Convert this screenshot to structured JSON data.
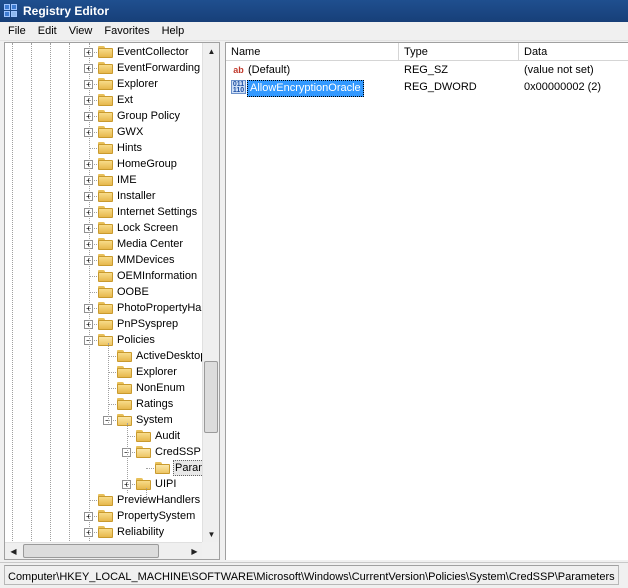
{
  "window": {
    "title": "Registry Editor"
  },
  "menu": [
    "File",
    "Edit",
    "View",
    "Favorites",
    "Help"
  ],
  "tree": {
    "items": [
      {
        "label": "EventCollector",
        "depth": 0,
        "expander": "plus"
      },
      {
        "label": "EventForwarding",
        "depth": 0,
        "expander": "plus"
      },
      {
        "label": "Explorer",
        "depth": 0,
        "expander": "plus"
      },
      {
        "label": "Ext",
        "depth": 0,
        "expander": "plus"
      },
      {
        "label": "Group Policy",
        "depth": 0,
        "expander": "plus"
      },
      {
        "label": "GWX",
        "depth": 0,
        "expander": "plus"
      },
      {
        "label": "Hints",
        "depth": 0,
        "expander": "none"
      },
      {
        "label": "HomeGroup",
        "depth": 0,
        "expander": "plus"
      },
      {
        "label": "IME",
        "depth": 0,
        "expander": "plus"
      },
      {
        "label": "Installer",
        "depth": 0,
        "expander": "plus"
      },
      {
        "label": "Internet Settings",
        "depth": 0,
        "expander": "plus"
      },
      {
        "label": "Lock Screen",
        "depth": 0,
        "expander": "plus"
      },
      {
        "label": "Media Center",
        "depth": 0,
        "expander": "plus"
      },
      {
        "label": "MMDevices",
        "depth": 0,
        "expander": "plus"
      },
      {
        "label": "OEMInformation",
        "depth": 0,
        "expander": "none"
      },
      {
        "label": "OOBE",
        "depth": 0,
        "expander": "none"
      },
      {
        "label": "PhotoPropertyHan",
        "depth": 0,
        "expander": "plus"
      },
      {
        "label": "PnPSysprep",
        "depth": 0,
        "expander": "plus"
      },
      {
        "label": "Policies",
        "depth": 0,
        "expander": "minus"
      },
      {
        "label": "ActiveDesktop",
        "depth": 1,
        "expander": "none"
      },
      {
        "label": "Explorer",
        "depth": 1,
        "expander": "none"
      },
      {
        "label": "NonEnum",
        "depth": 1,
        "expander": "none"
      },
      {
        "label": "Ratings",
        "depth": 1,
        "expander": "none"
      },
      {
        "label": "System",
        "depth": 1,
        "expander": "minus"
      },
      {
        "label": "Audit",
        "depth": 2,
        "expander": "none"
      },
      {
        "label": "CredSSP",
        "depth": 2,
        "expander": "minus"
      },
      {
        "label": "Parame",
        "depth": 3,
        "expander": "none",
        "selected": true
      },
      {
        "label": "UIPI",
        "depth": 2,
        "expander": "plus"
      },
      {
        "label": "PreviewHandlers",
        "depth": 0,
        "expander": "none"
      },
      {
        "label": "PropertySystem",
        "depth": 0,
        "expander": "plus"
      },
      {
        "label": "Reliability",
        "depth": 0,
        "expander": "plus"
      }
    ]
  },
  "list": {
    "columns": [
      "Name",
      "Type",
      "Data"
    ],
    "rows": [
      {
        "icon": "string-value-icon",
        "name": "(Default)",
        "type": "REG_SZ",
        "data": "(value not set)",
        "selected": false
      },
      {
        "icon": "dword-value-icon",
        "name": "AllowEncryptionOracle",
        "type": "REG_DWORD",
        "data": "0x00000002 (2)",
        "selected": true
      }
    ]
  },
  "status": {
    "path": "Computer\\HKEY_LOCAL_MACHINE\\SOFTWARE\\Microsoft\\Windows\\CurrentVersion\\Policies\\System\\CredSSP\\Parameters"
  },
  "colors": {
    "titlebar": "#1f4f8f",
    "selection": "#3399ff",
    "folder": "#f0c860"
  }
}
